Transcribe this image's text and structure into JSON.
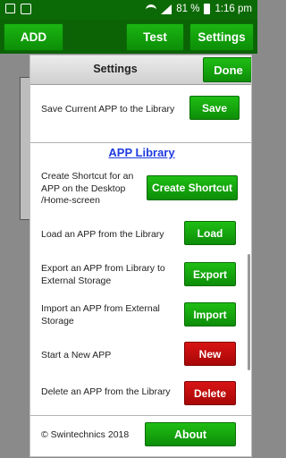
{
  "status_bar": {
    "battery": "81 %",
    "time": "1:16 pm"
  },
  "toolbar": {
    "add_label": "ADD",
    "test_label": "Test",
    "settings_label": "Settings"
  },
  "dialog": {
    "title": "Settings",
    "done_label": "Done",
    "save_text": "Save Current APP to the Library",
    "save_label": "Save",
    "library_title": "APP Library",
    "rows": [
      {
        "text": "Create Shortcut for an APP on the Desktop /Home-screen",
        "button": "Create Shortcut"
      },
      {
        "text": "Load an APP from the Library",
        "button": "Load"
      },
      {
        "text": "Export an APP from Library to External Storage",
        "button": "Export"
      },
      {
        "text": "Import an APP from External Storage",
        "button": "Import"
      },
      {
        "text": "Start a New APP",
        "button": "New"
      },
      {
        "text": "Delete an APP from the Library",
        "button": "Delete"
      }
    ],
    "copyright": "© Swintechnics 2018",
    "about_label": "About"
  },
  "colors": {
    "status_bar": "#0c6a06",
    "button_green": "#13a20c",
    "button_red": "#c10e0e",
    "link_blue": "#1f3be0"
  }
}
